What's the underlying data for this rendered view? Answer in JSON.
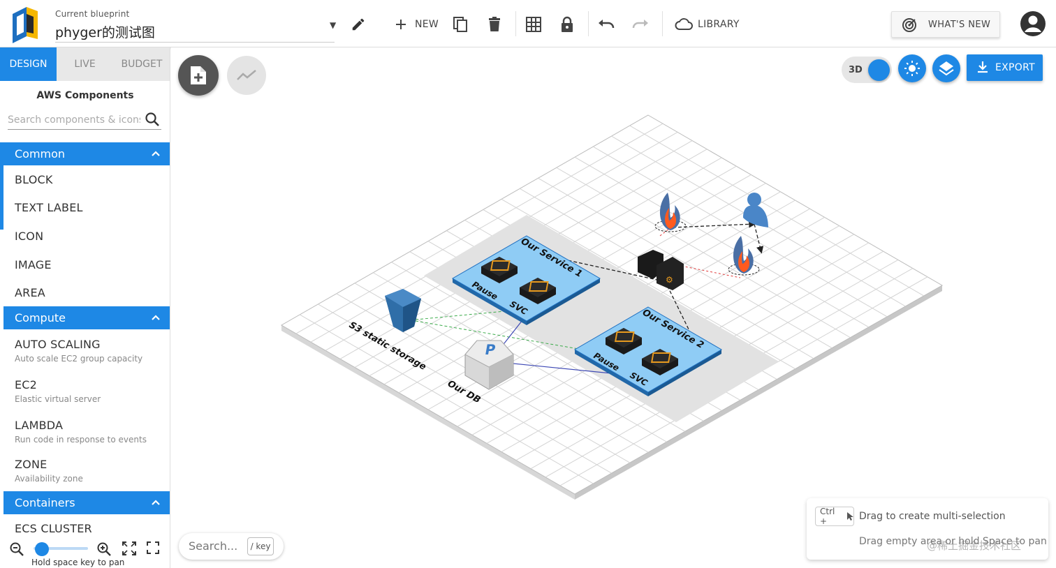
{
  "header": {
    "blueprint_label": "Current blueprint",
    "blueprint_name": "phyger的测试图",
    "new_label": "NEW",
    "library_label": "LIBRARY",
    "whats_new_label": "WHAT'S NEW"
  },
  "tabs": [
    {
      "label": "DESIGN",
      "active": true
    },
    {
      "label": "LIVE",
      "active": false
    },
    {
      "label": "BUDGET",
      "active": false
    }
  ],
  "components": {
    "title": "AWS Components",
    "search_placeholder": "Search components & icons...",
    "categories": [
      {
        "name": "Common",
        "items": [
          {
            "label": "BLOCK"
          },
          {
            "label": "TEXT LABEL"
          },
          {
            "label": "ICON"
          },
          {
            "label": "IMAGE"
          },
          {
            "label": "AREA"
          }
        ]
      },
      {
        "name": "Compute",
        "items": [
          {
            "label": "AUTO SCALING",
            "desc": "Auto scale EC2 group capacity"
          },
          {
            "label": "EC2",
            "desc": "Elastic virtual server"
          },
          {
            "label": "LAMBDA",
            "desc": "Run code in response to events"
          },
          {
            "label": "ZONE",
            "desc": "Availability zone"
          }
        ]
      },
      {
        "name": "Containers",
        "items": [
          {
            "label": "ECS CLUSTER"
          }
        ]
      }
    ]
  },
  "zoom": {
    "level": 0.05,
    "pan_hint": "Hold space key to pan"
  },
  "canvas": {
    "toggle_3d_label": "3D",
    "export_label": "EXPORT",
    "search_placeholder": "Search...",
    "search_key_hint": "/ key",
    "hint_key": "Ctrl +",
    "hint_multi_select": "Drag to create multi-selection",
    "hint_pan": "Drag empty area or hold Space to pan",
    "watermark": "@稀土掘金技术社区"
  },
  "diagram": {
    "labels": {
      "service1": "Our Service 1",
      "service2": "Our Service 2",
      "pause": "Pause",
      "svc": "SVC",
      "s3": "S3 static storage",
      "db": "Our DB",
      "db_letter": "P"
    }
  },
  "colors": {
    "accent": "#1e88e5",
    "service_area": "#8fccf5",
    "shadow_area": "#e2e2e2",
    "s3": "#2f6ea8",
    "user": "#4a86c8",
    "fire": "#ff5a1f"
  }
}
